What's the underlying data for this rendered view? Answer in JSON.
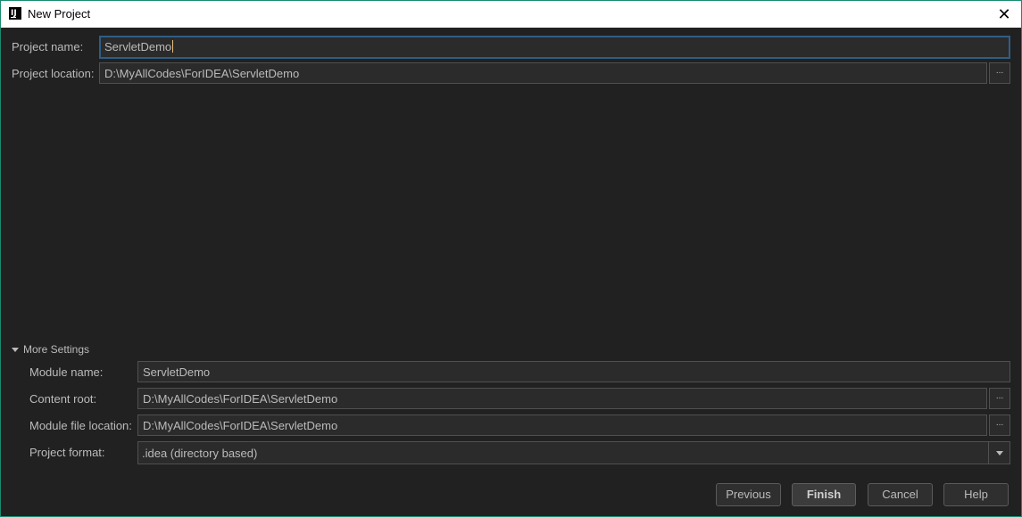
{
  "window": {
    "title": "New Project"
  },
  "form": {
    "project_name_label": "Project name:",
    "project_name_value": "ServletDemo",
    "project_location_label": "Project location:",
    "project_location_value": "D:\\MyAllCodes\\ForIDEA\\ServletDemo",
    "browse_label": "..."
  },
  "more_settings": {
    "toggle_label": "More Settings",
    "module_name_label": "Module name:",
    "module_name_value": "ServletDemo",
    "content_root_label": "Content root:",
    "content_root_value": "D:\\MyAllCodes\\ForIDEA\\ServletDemo",
    "module_file_location_label": "Module file location:",
    "module_file_location_value": "D:\\MyAllCodes\\ForIDEA\\ServletDemo",
    "project_format_label": "Project format:",
    "project_format_value": ".idea (directory based)"
  },
  "buttons": {
    "previous": "Previous",
    "finish": "Finish",
    "cancel": "Cancel",
    "help": "Help"
  },
  "icons": {
    "app": "intellij-idea-icon",
    "close": "close-icon",
    "expand": "triangle-down-icon",
    "dropdown": "chevron-down-icon"
  },
  "colors": {
    "background": "#212121",
    "titlebar": "#ffffff",
    "focus_border": "#2f5d86",
    "window_border": "#1b8a6e"
  }
}
